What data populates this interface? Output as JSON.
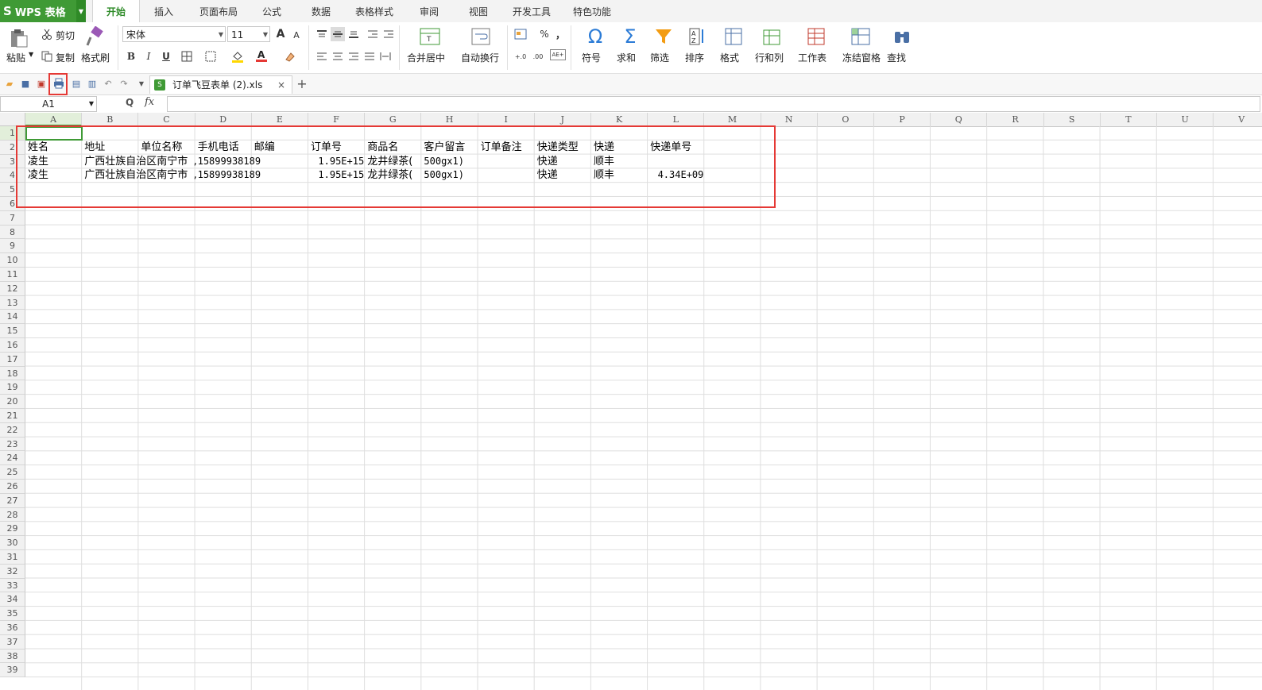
{
  "app": {
    "logo": "WPS 表格",
    "logo_icon": "S"
  },
  "menu": {
    "tabs": [
      {
        "label": "开始",
        "active": true
      },
      {
        "label": "插入"
      },
      {
        "label": "页面布局"
      },
      {
        "label": "公式"
      },
      {
        "label": "数据"
      },
      {
        "label": "表格样式"
      },
      {
        "label": "审阅"
      },
      {
        "label": "视图"
      },
      {
        "label": "开发工具"
      },
      {
        "label": "特色功能"
      }
    ]
  },
  "ribbon": {
    "paste": "粘贴",
    "cut": "剪切",
    "copy": "复制",
    "format_painter": "格式刷",
    "font_name": "宋体",
    "font_size": "11",
    "merge_center": "合并居中",
    "wrap_text": "自动换行",
    "symbol": "符号",
    "sum": "求和",
    "filter": "筛选",
    "sort": "排序",
    "format": "格式",
    "row_col": "行和列",
    "worksheet": "工作表",
    "freeze": "冻结窗格",
    "find": "查找",
    "bold": "B",
    "italic": "I",
    "underline": "U",
    "font_grow": "A",
    "font_shrink": "A",
    "percent": "%",
    "comma": "，",
    "sigma": "Σ",
    "omega": "Ω",
    "dec_inc": "+.0",
    "dec_dec": ".00",
    "special_ico": "AE+"
  },
  "quick_access": {
    "doc_tab": "订单飞豆表单 (2).xls",
    "xls_icon": "S",
    "close": "×",
    "new_tab": "+"
  },
  "formula_bar": {
    "name_box": "A1",
    "fx": "fx",
    "zoom_icon": "Q"
  },
  "columns": [
    "A",
    "B",
    "C",
    "D",
    "E",
    "F",
    "G",
    "H",
    "I",
    "J",
    "K",
    "L",
    "M",
    "N",
    "O",
    "P",
    "Q",
    "R",
    "S",
    "T",
    "U",
    "V"
  ],
  "rows": [
    "1",
    "2",
    "3",
    "4",
    "5",
    "6",
    "7",
    "8",
    "9",
    "10",
    "11",
    "12",
    "13",
    "14",
    "15",
    "16",
    "17",
    "18",
    "19",
    "20",
    "21",
    "22",
    "23",
    "24",
    "25",
    "26",
    "27",
    "28",
    "29",
    "30",
    "31",
    "32",
    "33",
    "34",
    "35",
    "36",
    "37",
    "38",
    "39"
  ],
  "sheet": {
    "header": [
      "姓名",
      "地址",
      "单位名称",
      "手机电话",
      "邮编",
      "订单号",
      "商品名",
      "客户留言",
      "订单备注",
      "快递类型",
      "快递",
      "快递单号"
    ],
    "row3": [
      "凌生",
      "广西壮族自治区南宁市",
      "",
      "15899938189",
      "",
      "1.95E+15",
      "龙井绿茶(",
      "500gx1)",
      "",
      "快递",
      "顺丰",
      ""
    ],
    "row4": [
      "凌生",
      "广西壮族自治区南宁市",
      "",
      "15899938189",
      "",
      "1.95E+15",
      "龙井绿茶(",
      "500gx1)",
      "",
      "快递",
      "顺丰",
      "4.34E+09"
    ],
    "c3_partial": "广西壮族",
    "c3_overflow": "自治区南宁",
    "d_prefix": ","
  }
}
